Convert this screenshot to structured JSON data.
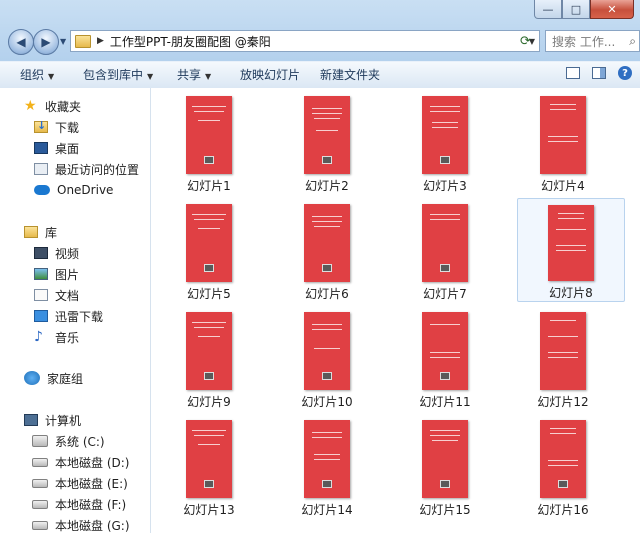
{
  "window": {
    "controls": {
      "minimize": "—",
      "maximize": "□",
      "close": "✕"
    }
  },
  "nav": {
    "path": "工作型PPT-朋友圈配图 @秦阳",
    "search_placeholder": "搜索 工作..."
  },
  "toolbar": {
    "organize": "组织",
    "include": "包含到库中",
    "share": "共享",
    "slideshow": "放映幻灯片",
    "new_folder": "新建文件夹"
  },
  "sidebar": {
    "favorites": "收藏夹",
    "downloads": "下载",
    "desktop": "桌面",
    "recent": "最近访问的位置",
    "onedrive": "OneDrive",
    "libraries": "库",
    "videos": "视频",
    "pictures": "图片",
    "documents": "文档",
    "thunder": "迅雷下载",
    "music": "音乐",
    "homegroup": "家庭组",
    "computer": "计算机",
    "drive_c": "系统 (C:)",
    "drive_d": "本地磁盘 (D:)",
    "drive_e": "本地磁盘 (E:)",
    "drive_f": "本地磁盘 (F:)",
    "drive_g": "本地磁盘 (G:)"
  },
  "files": [
    "幻灯片1",
    "幻灯片2",
    "幻灯片3",
    "幻灯片4",
    "幻灯片5",
    "幻灯片6",
    "幻灯片7",
    "幻灯片8",
    "幻灯片9",
    "幻灯片10",
    "幻灯片11",
    "幻灯片12",
    "幻灯片13",
    "幻灯片14",
    "幻灯片15",
    "幻灯片16"
  ],
  "selected_file": "幻灯片8",
  "colors": {
    "slide_red": "#e04044",
    "selection": "#b9d3ee"
  }
}
